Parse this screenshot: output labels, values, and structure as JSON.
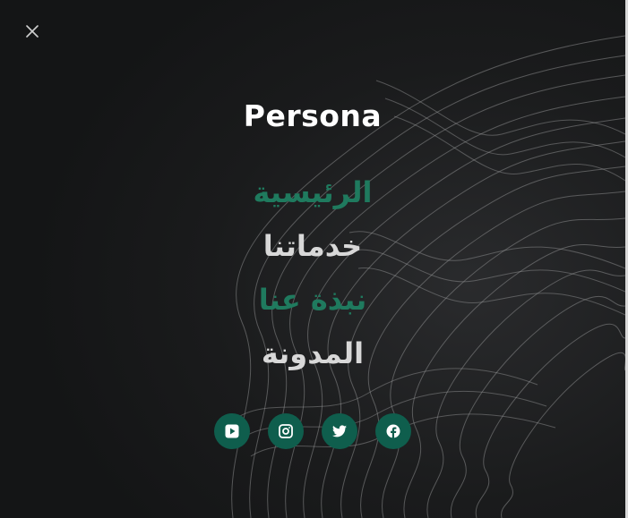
{
  "brand": {
    "name": "Persona"
  },
  "close": {
    "icon": "close-icon"
  },
  "nav": {
    "items": [
      {
        "label": "الرئيسية",
        "state": "active"
      },
      {
        "label": "خدماتنا",
        "state": "normal"
      },
      {
        "label": "نبذة عنا",
        "state": "accent"
      },
      {
        "label": "المدونة",
        "state": "normal"
      }
    ]
  },
  "social": {
    "items": [
      {
        "icon": "youtube-icon"
      },
      {
        "icon": "instagram-icon"
      },
      {
        "icon": "twitter-icon"
      },
      {
        "icon": "facebook-icon"
      }
    ]
  },
  "colors": {
    "background": "#141516",
    "accent": "#1f7a5e",
    "social_bg": "#0f5e4d",
    "text": "#d8d8d8"
  }
}
